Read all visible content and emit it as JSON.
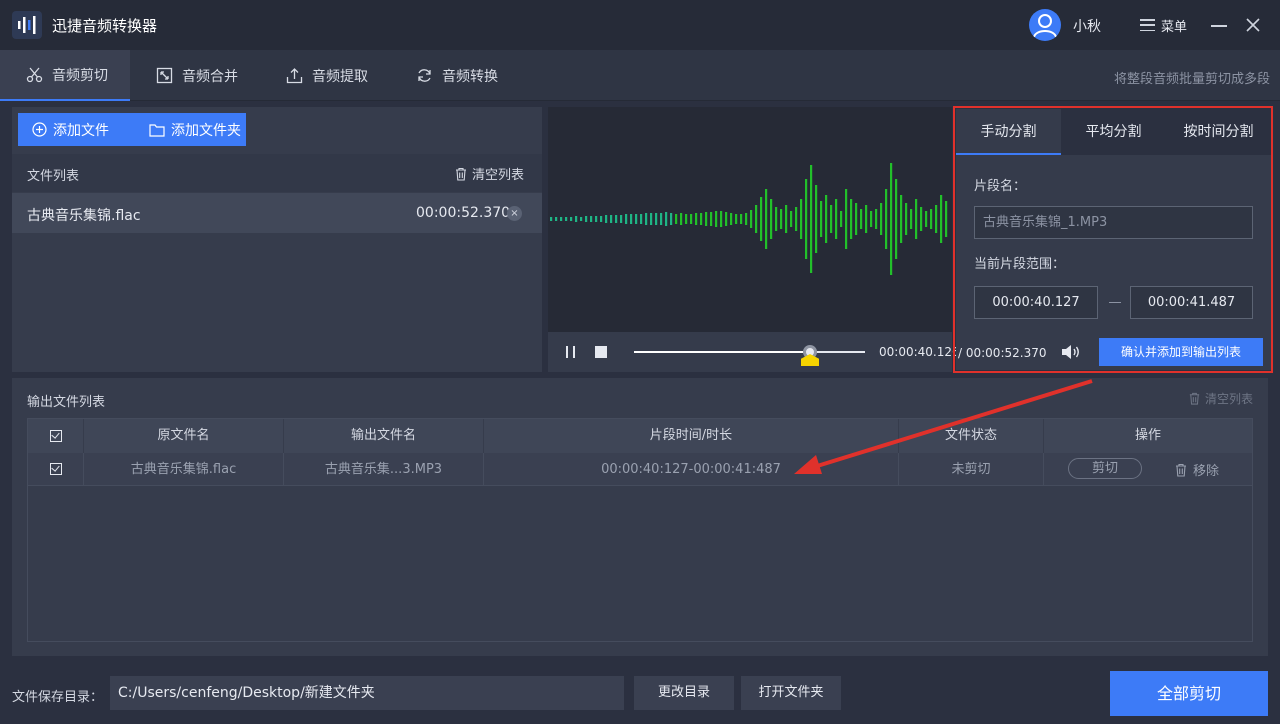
{
  "app": {
    "title": "迅捷音频转换器",
    "username": "小秋",
    "menu_label": "菜单"
  },
  "tabs": [
    {
      "label": "音频剪切",
      "icon": "scissors-icon",
      "active": true
    },
    {
      "label": "音频合并",
      "icon": "merge-icon"
    },
    {
      "label": "音频提取",
      "icon": "extract-icon"
    },
    {
      "label": "音频转换",
      "icon": "convert-icon"
    }
  ],
  "tab_hint": "将整段音频批量剪切成多段",
  "left": {
    "add_file": "添加文件",
    "add_folder": "添加文件夹",
    "file_list_title": "文件列表",
    "clear_list": "清空列表",
    "files": [
      {
        "name": "古典音乐集锦.flac",
        "duration": "00:00:52.370"
      }
    ]
  },
  "player": {
    "current_time": "00:00:40.126",
    "total_time": "/ 00:00:52.370",
    "progress": 0.766,
    "wave_color": "#22c02a"
  },
  "split": {
    "tabs": [
      "手动分割",
      "平均分割",
      "按时间分割"
    ],
    "segment_name_label": "片段名：",
    "segment_name_placeholder": "古典音乐集锦_1.MP3",
    "range_label": "当前片段范围：",
    "range_start": "00:00:40.127",
    "range_end": "00:00:41.487",
    "confirm_label": "确认并添加到输出列表"
  },
  "output": {
    "title": "输出文件列表",
    "clear_list": "清空列表",
    "columns": [
      "原文件名",
      "输出文件名",
      "片段时间/时长",
      "文件状态",
      "操作"
    ],
    "rows": [
      {
        "source": "古典音乐集锦.flac",
        "output": "古典音乐集...3.MP3",
        "segment": "00:00:40:127-00:00:41:487",
        "status": "未剪切",
        "cut": "剪切",
        "remove": "移除"
      }
    ]
  },
  "bottom": {
    "save_dir_label": "文件保存目录：",
    "save_dir_path": "C:/Users/cenfeng/Desktop/新建文件夹",
    "change_dir": "更改目录",
    "open_folder": "打开文件夹",
    "cut_all": "全部剪切"
  },
  "colors": {
    "accent": "#3d7bf7",
    "highlight": "#e0312b",
    "marker": "#f5d300"
  }
}
